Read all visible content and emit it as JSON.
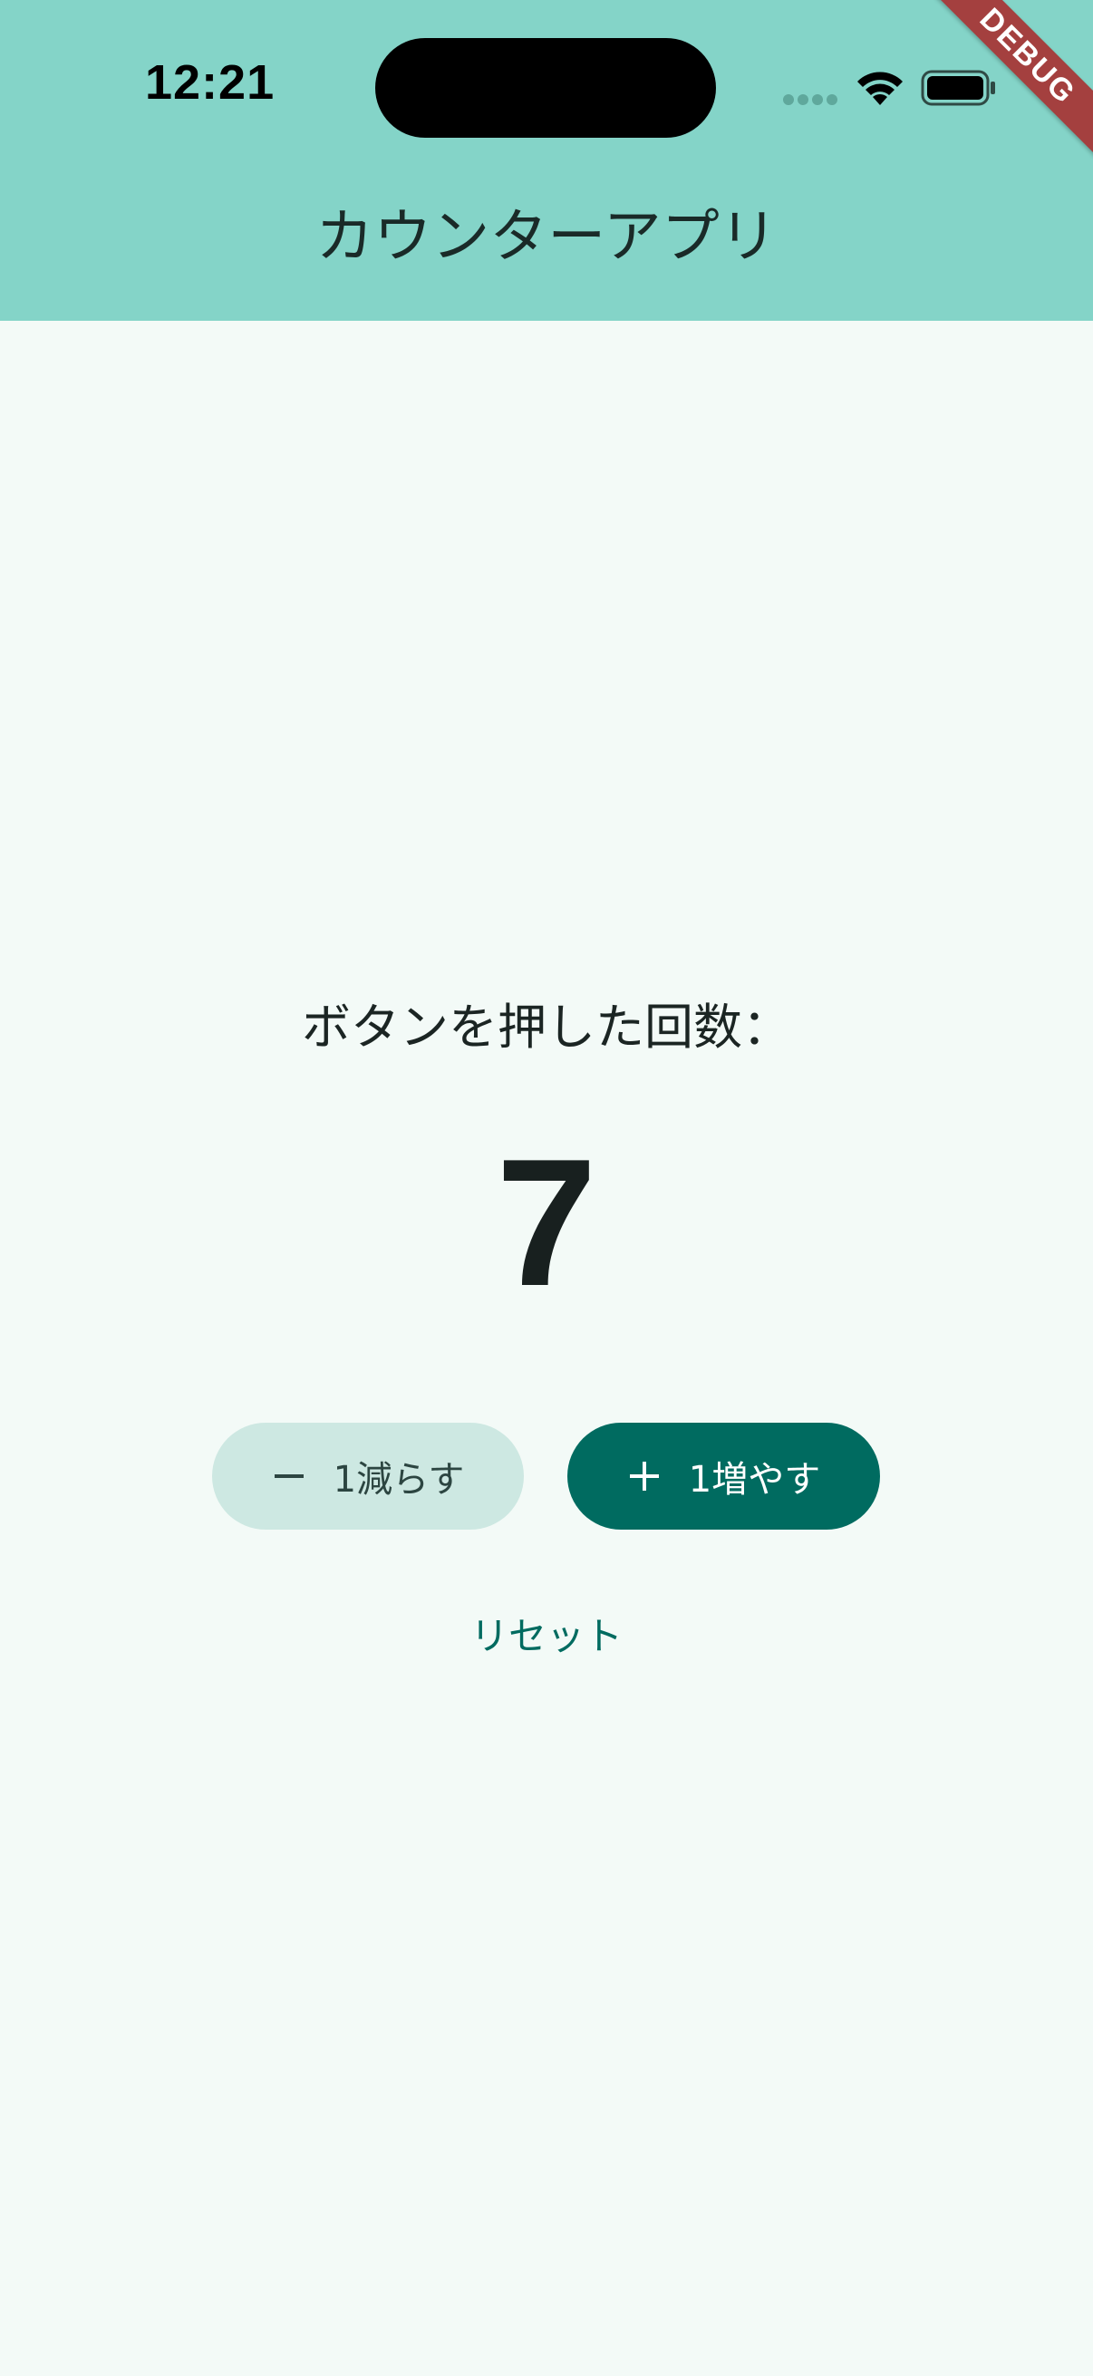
{
  "status_bar": {
    "time": "12:21",
    "wifi_icon": "wifi-icon",
    "battery_icon": "battery-icon",
    "signal_icon": "cellular-signal-icon"
  },
  "app_bar": {
    "title": "カウンターアプリ",
    "debug_banner": "DEBUG"
  },
  "counter": {
    "label": "ボタンを押した回数：",
    "value": "7"
  },
  "actions": {
    "decrement": {
      "label": "1減らす",
      "icon": "minus-icon"
    },
    "increment": {
      "label": "1増やす",
      "icon": "plus-icon"
    },
    "reset": {
      "label": "リセット"
    }
  },
  "colors": {
    "app_bar_bg": "#84d4c8",
    "page_bg": "#f3faf7",
    "primary": "#006b60",
    "secondary_container": "#cde8e2",
    "debug_ribbon": "#a4403f"
  }
}
